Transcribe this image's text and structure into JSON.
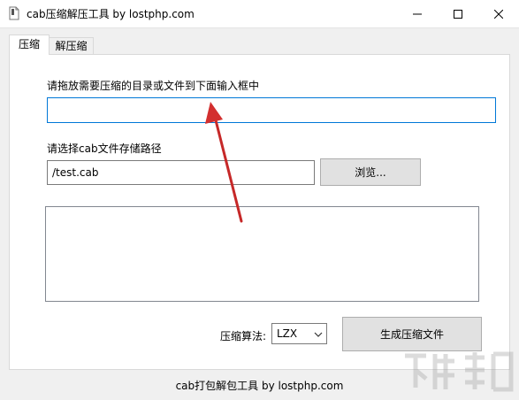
{
  "window": {
    "title": "cab压缩解压工具 by lostphp.com"
  },
  "tabs": [
    {
      "label": "压缩"
    },
    {
      "label": "解压缩"
    }
  ],
  "compress": {
    "drag_label": "请拖放需要压缩的目录或文件到下面输入框中",
    "drag_input_value": "",
    "save_label": "请选择cab文件存储路径",
    "save_path_value": "/test.cab",
    "browse_label": "浏览...",
    "algo_label": "压缩算法:",
    "algo_selected": "LZX",
    "generate_label": "生成压缩文件"
  },
  "footer": {
    "text": "cab打包解包工具 by lostphp.com"
  },
  "colors": {
    "focus_border": "#0078d7",
    "arrow": "#d32f2f"
  },
  "icons": {
    "app": "document-icon",
    "minimize": "minimize-icon",
    "maximize": "maximize-icon",
    "close": "close-icon",
    "dropdown": "chevron-down-icon",
    "pointer": "red-arrow-icon",
    "watermark": "watermark-logo"
  }
}
